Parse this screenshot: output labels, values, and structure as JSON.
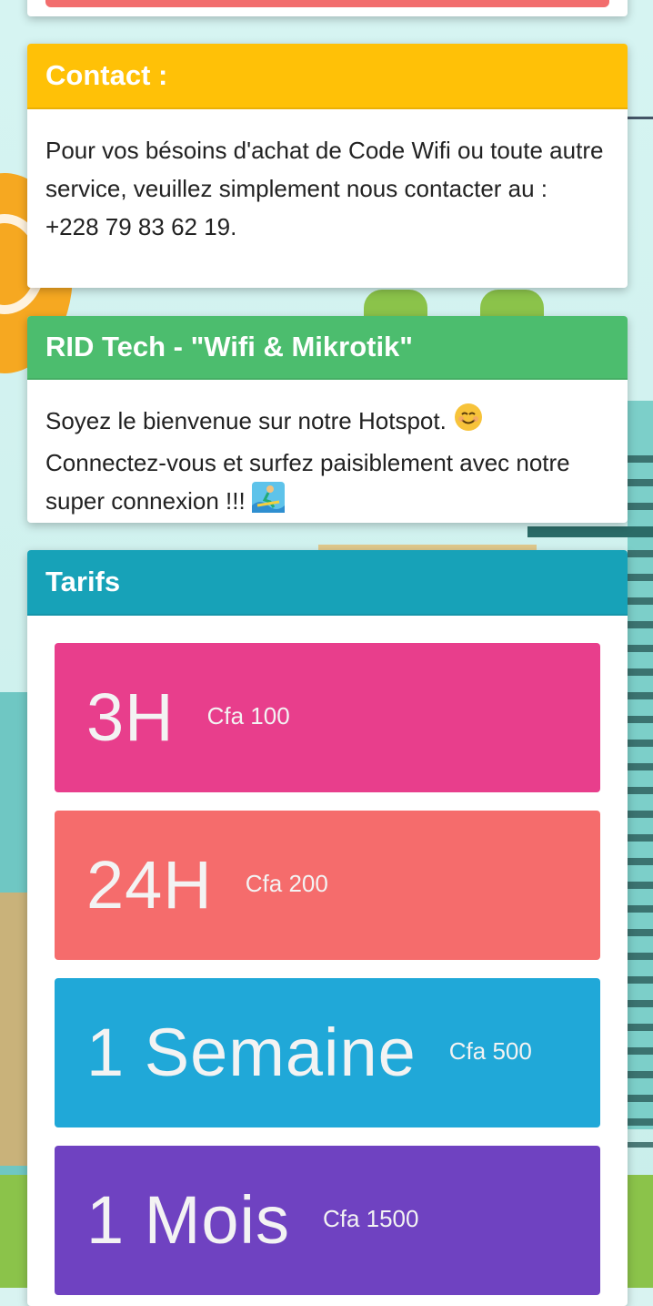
{
  "contact": {
    "title": "Contact :",
    "body": "Pour vos bésoins d'achat de Code Wifi ou toute autre service, veuillez simplement nous contacter au :",
    "phone": "+228 79 83 62 19."
  },
  "welcome": {
    "title": "RID Tech - \"Wifi & Mikrotik\"",
    "line1": "Soyez le bienvenue sur notre Hotspot.",
    "line2": "Connectez-vous et surfez paisiblement avec notre super connexion !!!",
    "icons": [
      "smiling-face-emoji",
      "surfer-emoji"
    ]
  },
  "tarifs": {
    "title": "Tarifs",
    "plans": [
      {
        "duration": "3H",
        "price": "Cfa 100",
        "color": "#e83e8c"
      },
      {
        "duration": "24H",
        "price": "Cfa 200",
        "color": "#f56c6c"
      },
      {
        "duration": "1 Semaine",
        "price": "Cfa 500",
        "color": "#20a8d8"
      },
      {
        "duration": "1 Mois",
        "price": "Cfa 1500",
        "color": "#6f42c1"
      }
    ]
  },
  "colors": {
    "contact_header": "#ffc107",
    "welcome_header": "#4cbd6e",
    "tarifs_header": "#17a2b8"
  }
}
